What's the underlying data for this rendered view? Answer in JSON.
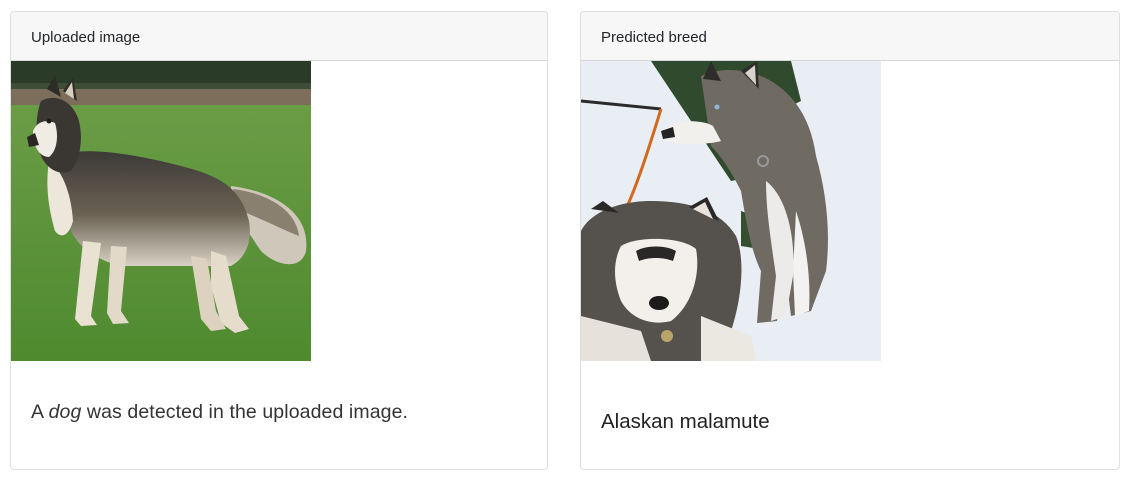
{
  "uploaded_card": {
    "header": "Uploaded image",
    "image": "husky standing on grass",
    "result_prefix": "A ",
    "result_species": "dog",
    "result_suffix": " was detected in the uploaded image."
  },
  "predicted_card": {
    "header": "Predicted breed",
    "image": "two huskies in snow",
    "breed": "Alaskan malamute"
  },
  "colors": {
    "header_bg": "#f7f7f7",
    "border": "#dfdfdf",
    "grass": "#5a8f3a",
    "snow": "#e8ecf3"
  }
}
